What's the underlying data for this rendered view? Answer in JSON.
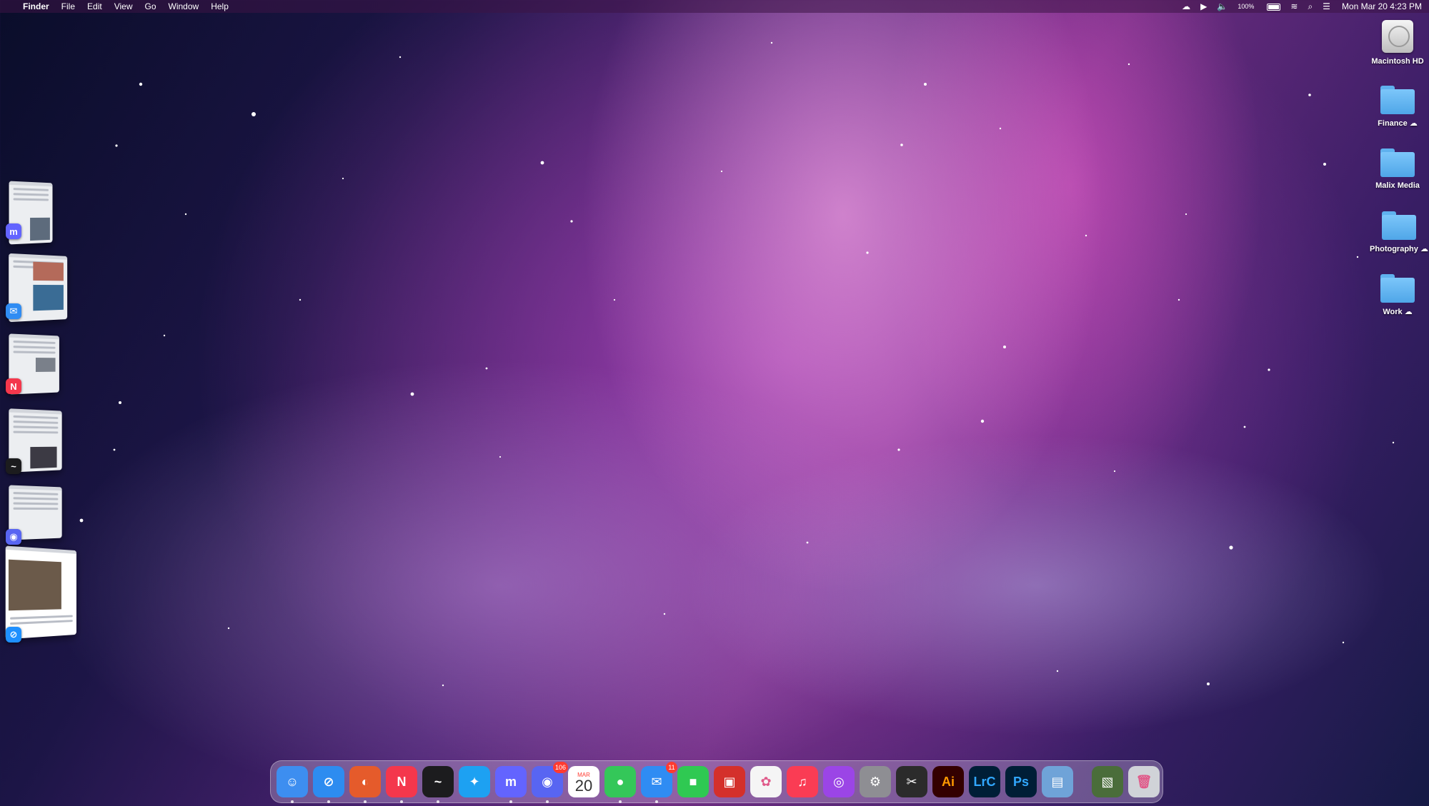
{
  "menubar": {
    "apple": "",
    "app_name": "Finder",
    "menus": [
      "File",
      "Edit",
      "View",
      "Go",
      "Window",
      "Help"
    ],
    "battery_percent": "100%",
    "clock": "Mon Mar 20  4:23 PM"
  },
  "desktop_icons": [
    {
      "label": "Macintosh HD",
      "icon": "hard-drive-icon"
    },
    {
      "label": "Finance",
      "icon": "folder-icon",
      "cloud": true
    },
    {
      "label": "Malix Media",
      "icon": "folder-icon"
    },
    {
      "label": "Photography",
      "icon": "folder-icon",
      "cloud": true
    },
    {
      "label": "Work",
      "icon": "folder-icon",
      "cloud": true
    }
  ],
  "stage_manager": [
    {
      "app": "Mastodon",
      "icon": "mastodon-icon",
      "color": "#6364ff",
      "glyph": "m"
    },
    {
      "app": "Mail",
      "icon": "mail-icon",
      "color": "#2f8cf3",
      "glyph": "✉"
    },
    {
      "app": "News",
      "icon": "news-icon",
      "color": "#f4374c",
      "glyph": "N"
    },
    {
      "app": "Stocks",
      "icon": "stocks-icon",
      "color": "#1c1c1e",
      "glyph": "~"
    },
    {
      "app": "Discord",
      "icon": "discord-icon",
      "color": "#5865f2",
      "glyph": "◉"
    },
    {
      "app": "Safari",
      "icon": "safari-icon",
      "color": "#1e90ff",
      "glyph": "⊘"
    }
  ],
  "dock": {
    "apps": [
      {
        "name": "Finder",
        "icon": "finder-icon",
        "color": "#3d8ef0",
        "glyph": "☺",
        "running": true
      },
      {
        "name": "Safari",
        "icon": "safari-icon",
        "color": "#2d8cf0",
        "glyph": "⊘",
        "running": true
      },
      {
        "name": "Firefox",
        "icon": "firefox-icon",
        "color": "#e55b2b",
        "glyph": "◐",
        "running": true
      },
      {
        "name": "News",
        "icon": "news-icon",
        "color": "#f4374c",
        "glyph": "N",
        "running": true
      },
      {
        "name": "Stocks",
        "icon": "stocks-icon",
        "color": "#1c1c1e",
        "glyph": "~",
        "running": true
      },
      {
        "name": "Twitter",
        "icon": "twitter-icon",
        "color": "#1da1f2",
        "glyph": "✦",
        "running": false
      },
      {
        "name": "Mastodon",
        "icon": "mastodon-icon",
        "color": "#6364ff",
        "glyph": "m",
        "running": true
      },
      {
        "name": "Discord",
        "icon": "discord-icon",
        "color": "#5865f2",
        "glyph": "◉",
        "running": true,
        "badge": "106"
      },
      {
        "name": "Calendar",
        "icon": "calendar-icon",
        "color": "#ffffff",
        "calendar": true,
        "month": "MAR",
        "day": "20",
        "running": false
      },
      {
        "name": "Messages",
        "icon": "messages-icon",
        "color": "#34c759",
        "glyph": "●",
        "running": true
      },
      {
        "name": "Mail",
        "icon": "mail-icon",
        "color": "#2f8cf3",
        "glyph": "✉",
        "running": true,
        "badge": "11"
      },
      {
        "name": "FaceTime",
        "icon": "facetime-icon",
        "color": "#2fc952",
        "glyph": "■",
        "running": false
      },
      {
        "name": "Photo Booth",
        "icon": "photo-booth-icon",
        "color": "#d4302b",
        "glyph": "▣",
        "running": false
      },
      {
        "name": "Photos",
        "icon": "photos-icon",
        "color": "#f5f5f5",
        "glyph": "✿",
        "running": false
      },
      {
        "name": "Music",
        "icon": "music-icon",
        "color": "#fa3c54",
        "glyph": "♫",
        "running": false
      },
      {
        "name": "Podcasts",
        "icon": "podcasts-icon",
        "color": "#9b45e6",
        "glyph": "◎",
        "running": false
      },
      {
        "name": "System Settings",
        "icon": "settings-icon",
        "color": "#8e8e93",
        "glyph": "⚙",
        "running": false
      },
      {
        "name": "Final Cut Pro",
        "icon": "final-cut-icon",
        "color": "#2b2b2b",
        "glyph": "✂",
        "running": false
      },
      {
        "name": "Illustrator",
        "icon": "illustrator-icon",
        "color": "#330000",
        "glyph": "Ai",
        "text_color": "#ff9a00",
        "running": false
      },
      {
        "name": "Lightroom Classic",
        "icon": "lightroom-icon",
        "color": "#001e36",
        "glyph": "LrC",
        "text_color": "#31a8ff",
        "running": false
      },
      {
        "name": "Photoshop",
        "icon": "photoshop-icon",
        "color": "#001e36",
        "glyph": "Ps",
        "text_color": "#31a8ff",
        "running": false
      },
      {
        "name": "Preview",
        "icon": "preview-icon",
        "color": "#6fa3d8",
        "glyph": "▤",
        "running": false
      }
    ],
    "others": [
      {
        "name": "Downloads",
        "icon": "image-stack-icon",
        "color": "#4a6d3a",
        "glyph": "▧"
      },
      {
        "name": "Trash",
        "icon": "trash-icon",
        "color": "#d0d3d8",
        "glyph": "🗑"
      }
    ]
  }
}
